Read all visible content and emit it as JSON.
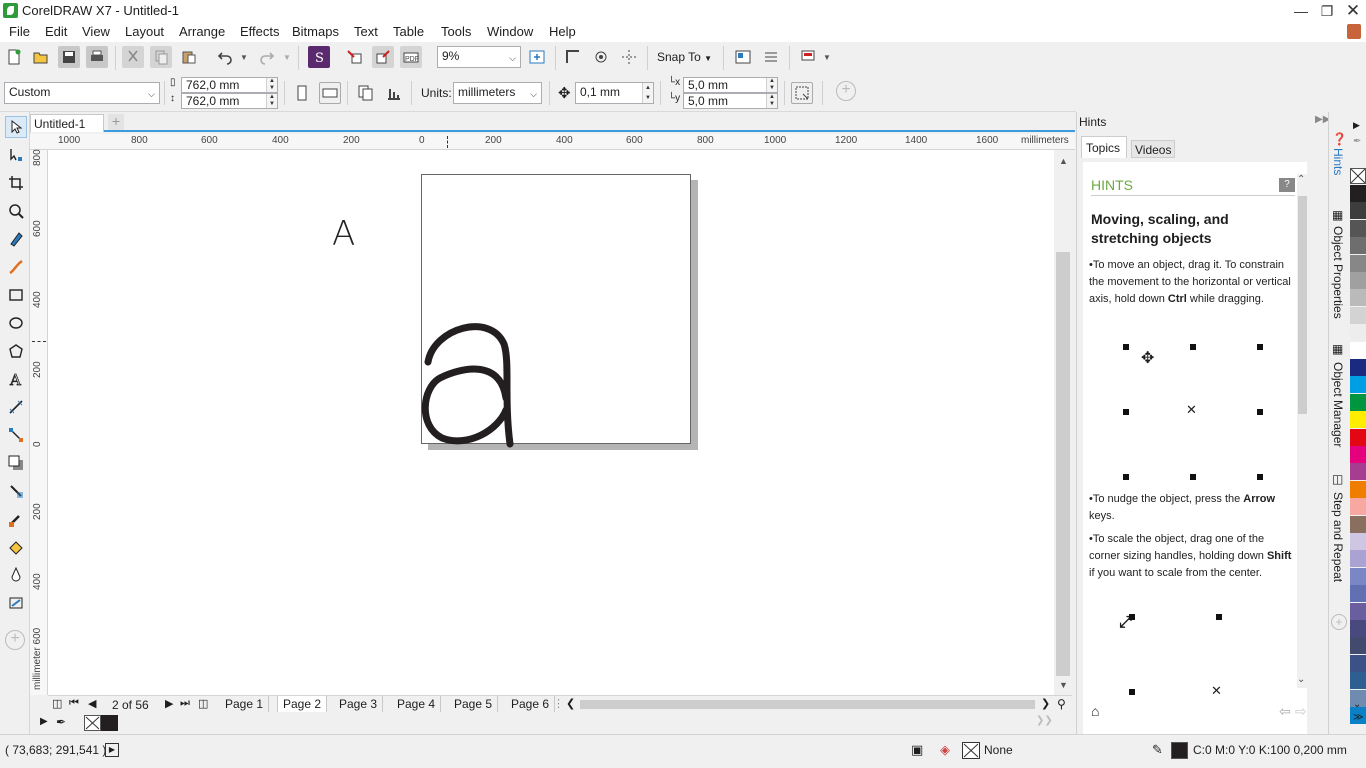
{
  "app": {
    "title": "CorelDRAW X7 - Untitled-1"
  },
  "menu": [
    "File",
    "Edit",
    "View",
    "Layout",
    "Arrange",
    "Effects",
    "Bitmaps",
    "Text",
    "Table",
    "Tools",
    "Window",
    "Help"
  ],
  "standard_toolbar": {
    "zoom": "9%",
    "snap_to": "Snap To"
  },
  "property_bar": {
    "page_size_preset": "Custom",
    "width": "762,0 mm",
    "height": "762,0 mm",
    "units_label": "Units:",
    "units": "millimeters",
    "nudge": "0,1 mm",
    "dup_x": "5,0 mm",
    "dup_y": "5,0 mm"
  },
  "document_tab": "Untitled-1",
  "rulers": {
    "h_labels": [
      "1000",
      "800",
      "600",
      "400",
      "200",
      "0",
      "200",
      "400",
      "600",
      "800",
      "1000",
      "1200",
      "1400",
      "1600",
      "millimeters"
    ],
    "v_labels": [
      "800",
      "600",
      "400",
      "200",
      "0",
      "200",
      "400",
      "millimeter 600"
    ]
  },
  "canvas": {
    "letter_upper": "A"
  },
  "page_nav": {
    "counter": "2 of 56",
    "pages": [
      "Page 1",
      "Page 2",
      "Page 3",
      "Page 4",
      "Page 5",
      "Page 6"
    ],
    "active": "Page 2"
  },
  "status": {
    "coords": "( 73,683; 291,541 )",
    "fill": "None",
    "outline": "C:0 M:0 Y:0 K:100  0,200 mm"
  },
  "hints_panel": {
    "title": "Hints",
    "tabs": [
      "Topics",
      "Videos"
    ],
    "heading": "HINTS",
    "topic": "Moving, scaling, and stretching objects",
    "p1_pre": "To move an object, drag it. To constrain the movement to the horizontal or vertical axis, hold down ",
    "p1_key": "Ctrl",
    "p1_post": " while dragging.",
    "p2_pre": "To nudge the object, press the ",
    "p2_key": "Arrow",
    "p2_post": " keys.",
    "p3_pre": "To scale the object, drag one of the corner sizing handles, holding down ",
    "p3_key": "Shift",
    "p3_post": " if you want to scale from the center."
  },
  "docker_tabs": [
    "Hints",
    "Object Properties",
    "Object Manager",
    "Step and Repeat"
  ],
  "palette_colors": [
    "#231f20",
    "#3d3d3d",
    "#555555",
    "#6e6e6e",
    "#878787",
    "#a0a0a0",
    "#bababa",
    "#d3d3d3",
    "#ededed",
    "#ffffff",
    "#1a2a80",
    "#009fe3",
    "#00963f",
    "#ffed00",
    "#e30613",
    "#e5007d",
    "#a63d90",
    "#ef7d00",
    "#f7a8a0",
    "#8b6f5e",
    "#cfc6e3",
    "#a9a2d2",
    "#7b86c4",
    "#6170b3",
    "#695f9e",
    "#49487f",
    "#424b6d",
    "#3c5186",
    "#2f5e90",
    "#6f8bb0",
    "#0a80c6"
  ]
}
